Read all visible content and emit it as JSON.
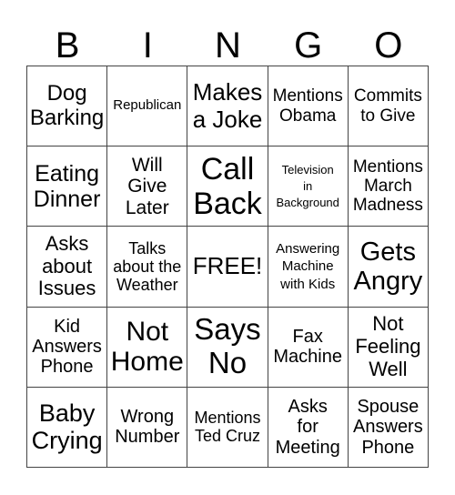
{
  "header": [
    "B",
    "I",
    "N",
    "G",
    "O"
  ],
  "cells": [
    "Dog\nBarking",
    "Republican",
    "Makes\na Joke",
    "Mentions\nObama",
    "Commits\nto Give",
    "Eating\nDinner",
    "Will\nGive\nLater",
    "Call\nBack",
    "Television\nin\nBackground",
    "Mentions\nMarch\nMadness",
    "Asks\nabout\nIssues",
    "Talks\nabout the\nWeather",
    "FREE!",
    "Answering\nMachine\nwith Kids",
    "Gets\nAngry",
    "Kid\nAnswers\nPhone",
    "Not\nHome",
    "Says\nNo",
    "Fax\nMachine",
    "Not\nFeeling\nWell",
    "Baby\nCrying",
    "Wrong\nNumber",
    "Mentions\nTed Cruz",
    "Asks\nfor\nMeeting",
    "Spouse\nAnswers\nPhone"
  ]
}
